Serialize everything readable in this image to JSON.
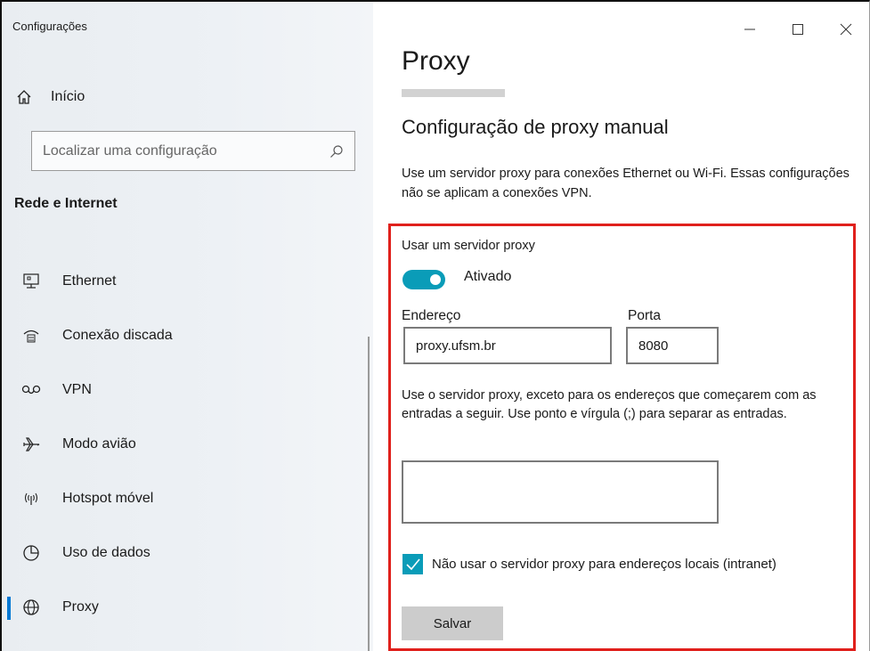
{
  "window": {
    "app_title": "Configurações",
    "controls": [
      "minimize",
      "maximize",
      "close"
    ]
  },
  "sidebar": {
    "home_label": "Início",
    "search": {
      "placeholder": "Localizar uma configuração"
    },
    "section_title": "Rede e Internet",
    "items": [
      {
        "label": "Ethernet",
        "icon": "ethernet-icon"
      },
      {
        "label": "Conexão discada",
        "icon": "dialup-icon"
      },
      {
        "label": "VPN",
        "icon": "vpn-icon"
      },
      {
        "label": "Modo avião",
        "icon": "airplane-icon"
      },
      {
        "label": "Hotspot móvel",
        "icon": "hotspot-icon"
      },
      {
        "label": "Uso de dados",
        "icon": "data-usage-icon"
      },
      {
        "label": "Proxy",
        "icon": "globe-icon",
        "active": true
      }
    ]
  },
  "main": {
    "title": "Proxy",
    "subtitle": "Configuração de proxy manual",
    "description": "Use um servidor proxy para conexões Ethernet ou Wi-Fi. Essas configurações não se aplicam a conexões VPN.",
    "use_proxy_label": "Usar um servidor proxy",
    "toggle": {
      "state": "Ativado",
      "on": true
    },
    "address_label": "Endereço",
    "address_value": "proxy.ufsm.br",
    "port_label": "Porta",
    "port_value": "8080",
    "exceptions_description": "Use o servidor proxy, exceto para os endereços que começarem com as entradas a seguir. Use ponto e vírgula (;) para separar as entradas.",
    "exceptions_value": "",
    "local_checkbox": {
      "label": "Não usar o servidor proxy para endereços locais (intranet)",
      "checked": true
    },
    "save_label": "Salvar"
  },
  "colors": {
    "accent": "#0a9cb8",
    "highlight_border": "#e0201c",
    "active_indicator": "#0078d4"
  }
}
